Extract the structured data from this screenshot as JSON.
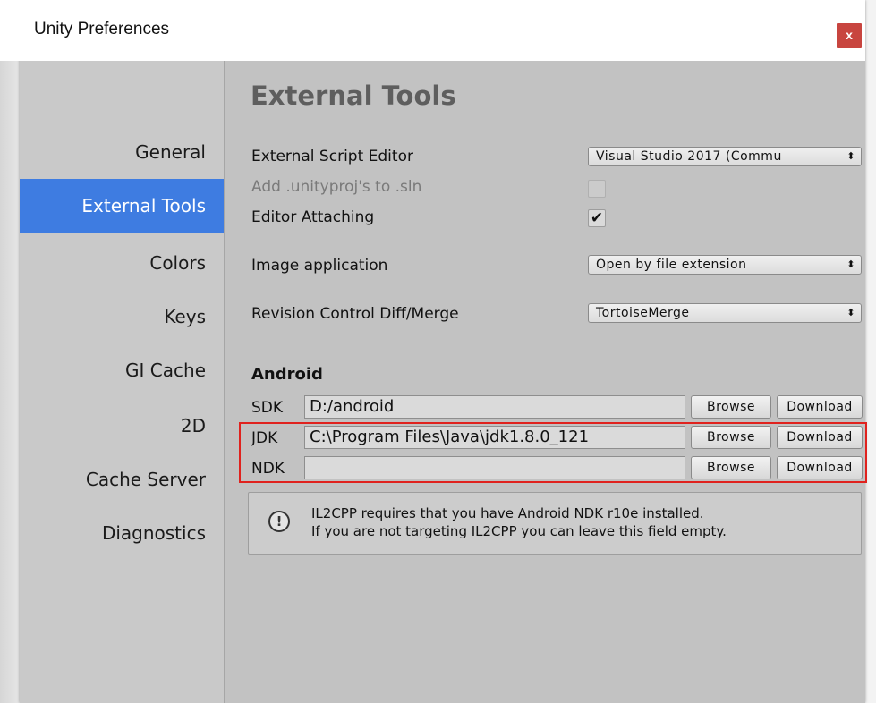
{
  "window": {
    "title": "Unity Preferences",
    "close_label": "x"
  },
  "sidebar": {
    "items": [
      {
        "label": "General",
        "active": false
      },
      {
        "label": "External Tools",
        "active": true
      },
      {
        "label": "Colors",
        "active": false
      },
      {
        "label": "Keys",
        "active": false
      },
      {
        "label": "GI Cache",
        "active": false
      },
      {
        "label": "2D",
        "active": false
      },
      {
        "label": "Cache Server",
        "active": false
      },
      {
        "label": "Diagnostics",
        "active": false
      }
    ]
  },
  "main": {
    "heading": "External Tools",
    "script_editor": {
      "label": "External Script Editor",
      "value": "Visual Studio 2017 (Commu"
    },
    "add_unityproj": {
      "label": "Add .unityproj's to .sln",
      "checked": false,
      "enabled": false
    },
    "editor_attaching": {
      "label": "Editor Attaching",
      "checked": true,
      "check_glyph": "✔"
    },
    "image_application": {
      "label": "Image application",
      "value": "Open by file extension"
    },
    "revision_control": {
      "label": "Revision Control Diff/Merge",
      "value": "TortoiseMerge"
    },
    "dropdown_arrow": "⬍",
    "android": {
      "title": "Android",
      "browse_label": "Browse",
      "download_label": "Download",
      "sdk": {
        "label": "SDK",
        "value": "D:/android"
      },
      "jdk": {
        "label": "JDK",
        "value": "C:\\Program Files\\Java\\jdk1.8.0_121"
      },
      "ndk": {
        "label": "NDK",
        "value": ""
      }
    },
    "info": {
      "icon": "!",
      "line1": "IL2CPP requires that you have Android NDK r10e installed.",
      "line2": "If you are not targeting IL2CPP you can leave this field empty."
    }
  },
  "colors": {
    "accent": "#3e7ce1",
    "close_button": "#c8453f",
    "highlight_box": "#e0221e"
  }
}
